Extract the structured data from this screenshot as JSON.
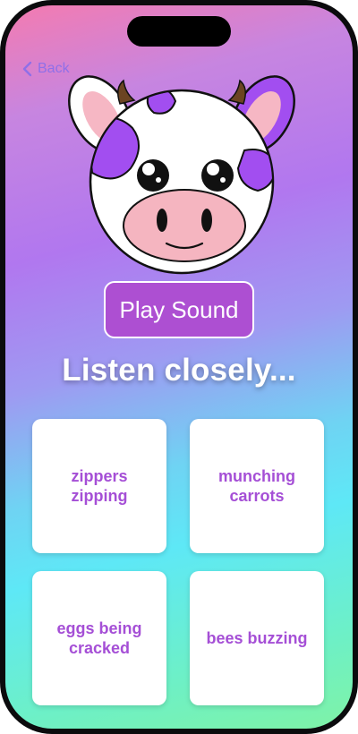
{
  "nav": {
    "back_label": "Back"
  },
  "main": {
    "play_button_label": "Play Sound",
    "prompt": "Listen closely..."
  },
  "answers": [
    {
      "label": "zippers zipping"
    },
    {
      "label": "munching carrots"
    },
    {
      "label": "eggs being cracked"
    },
    {
      "label": "bees buzzing"
    }
  ],
  "colors": {
    "accent": "#ad4fd2",
    "answer_text": "#a54fd6",
    "back_link": "#8f6fe8",
    "cow_spot": "#a24ef0",
    "cow_nose": "#f5b5c0"
  },
  "icons": {
    "back": "chevron-left-icon",
    "mascot": "cow-face-illustration"
  }
}
